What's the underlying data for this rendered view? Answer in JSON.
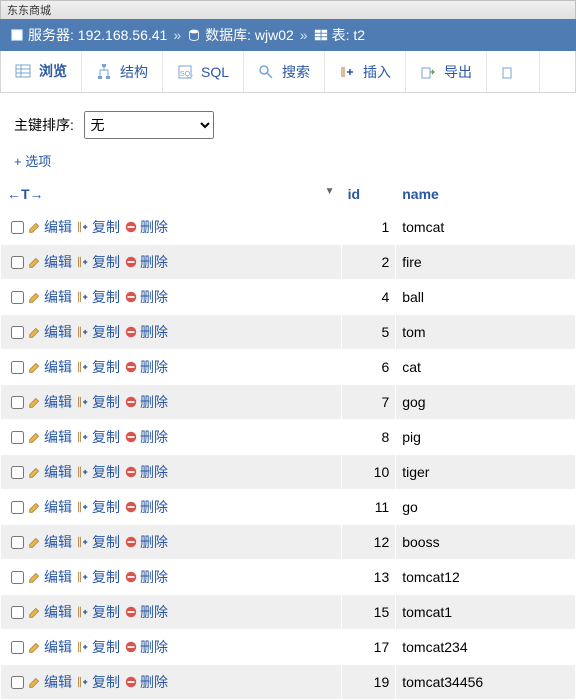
{
  "browser_tab": "东东商城",
  "breadcrumb": {
    "server_label": "服务器:",
    "server_value": "192.168.56.41",
    "db_label": "数据库:",
    "db_value": "wjw02",
    "table_label": "表:",
    "table_value": "t2"
  },
  "toolbar": {
    "browse": "浏览",
    "structure": "结构",
    "sql": "SQL",
    "search": "搜索",
    "insert": "插入",
    "export": "导出"
  },
  "controls": {
    "pk_sort_label": "主键排序:",
    "pk_sort_selected": "无"
  },
  "options_link": "+ 选项",
  "table_headers": {
    "actions": "←T→",
    "id": "id",
    "name": "name"
  },
  "row_actions": {
    "edit": "编辑",
    "copy": "复制",
    "delete": "删除"
  },
  "rows": [
    {
      "id": "1",
      "name": "tomcat"
    },
    {
      "id": "2",
      "name": "fire"
    },
    {
      "id": "4",
      "name": "ball"
    },
    {
      "id": "5",
      "name": "tom"
    },
    {
      "id": "6",
      "name": "cat"
    },
    {
      "id": "7",
      "name": "gog"
    },
    {
      "id": "8",
      "name": "pig"
    },
    {
      "id": "10",
      "name": "tiger"
    },
    {
      "id": "11",
      "name": "go"
    },
    {
      "id": "12",
      "name": "booss"
    },
    {
      "id": "13",
      "name": "tomcat12"
    },
    {
      "id": "15",
      "name": "tomcat1"
    },
    {
      "id": "17",
      "name": "tomcat234"
    },
    {
      "id": "19",
      "name": "tomcat34456"
    }
  ]
}
